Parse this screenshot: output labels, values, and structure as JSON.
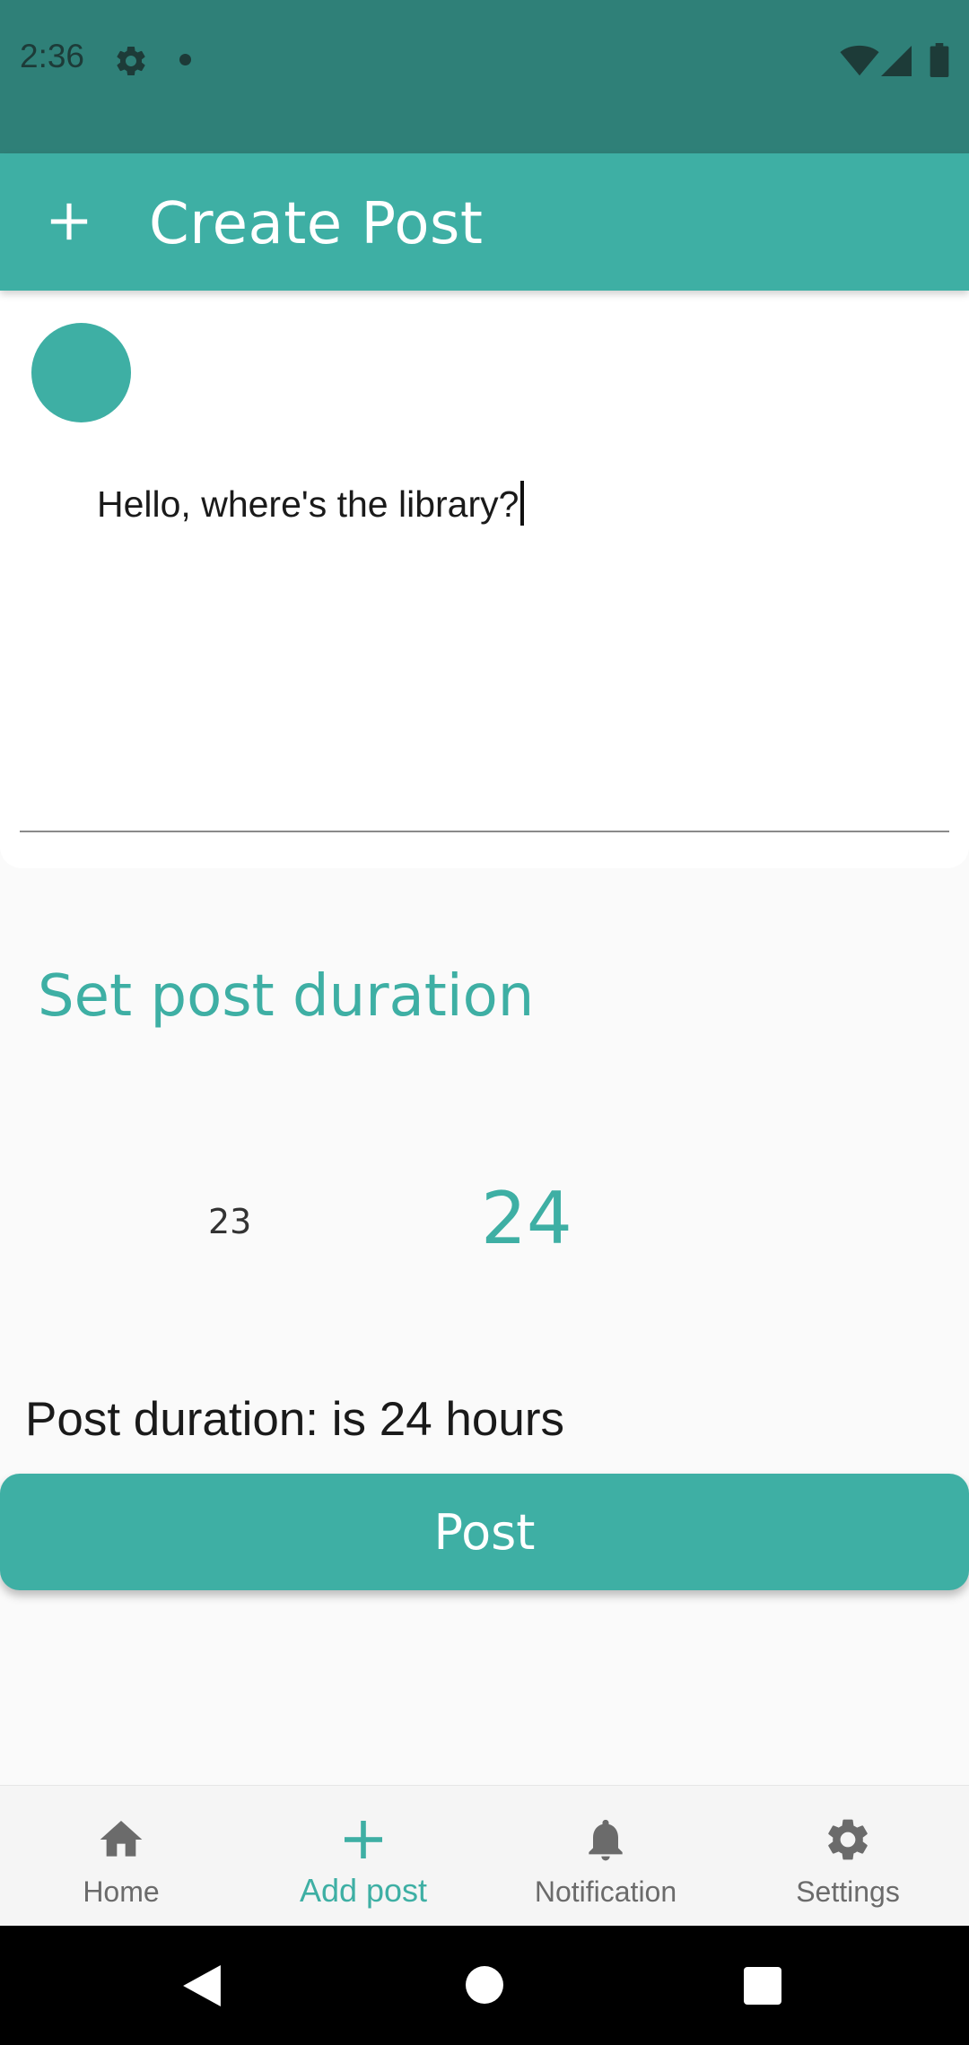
{
  "status_bar": {
    "time": "2:36",
    "icons": [
      "settings-icon",
      "notification-dot",
      "wifi-icon",
      "signal-icon",
      "battery-icon"
    ]
  },
  "app_bar": {
    "icon": "plus-icon",
    "title": "Create Post"
  },
  "compose": {
    "text_value": "Hello, where's the library?"
  },
  "duration": {
    "title": "Set post duration",
    "picker_previous": "23",
    "picker_selected": "24",
    "summary": "Post duration: is 24 hours"
  },
  "post_button": {
    "label": "Post"
  },
  "bottom_nav": {
    "items": [
      {
        "label": "Home",
        "icon": "home-icon",
        "active": false
      },
      {
        "label": "Add post",
        "icon": "plus-icon",
        "active": true
      },
      {
        "label": "Notification",
        "icon": "bell-icon",
        "active": false
      },
      {
        "label": "Settings",
        "icon": "gear-icon",
        "active": false
      }
    ]
  },
  "colors": {
    "status_bar": "#2f8078",
    "primary": "#3eafa4",
    "background": "#fafafa",
    "nav_inactive": "#6b6b6b"
  }
}
